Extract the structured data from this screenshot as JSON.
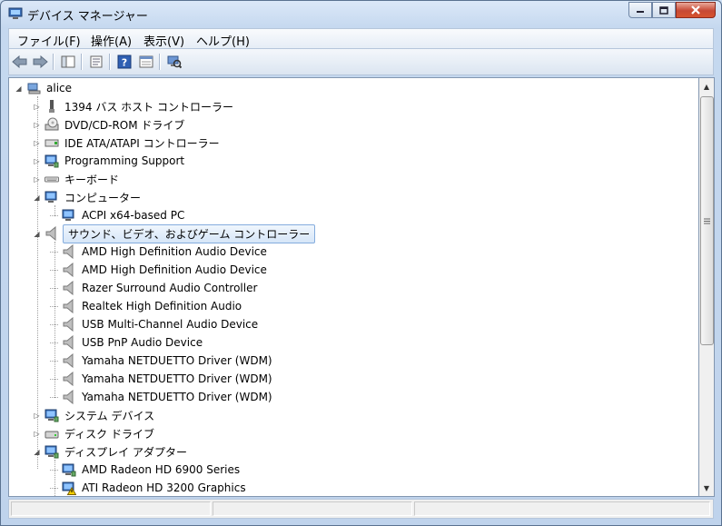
{
  "window": {
    "title": "デバイス マネージャー"
  },
  "menu": [
    {
      "label": "ファイル(F)"
    },
    {
      "label": "操作(A)"
    },
    {
      "label": "表示(V)"
    },
    {
      "label": "ヘルプ(H)"
    }
  ],
  "toolbar": {
    "buttons": [
      "back-arrow-icon",
      "forward-arrow-icon",
      "show-hide-tree-icon",
      "properties-icon",
      "help-icon",
      "view-icon",
      "scan-hardware-icon"
    ]
  },
  "tree": {
    "root": "alice",
    "items": [
      {
        "label": "1394 バス ホスト コントローラー",
        "icon": "bus-icon",
        "level": 1,
        "state": "collapsed"
      },
      {
        "label": "DVD/CD-ROM ドライブ",
        "icon": "dvd-icon",
        "level": 1,
        "state": "collapsed"
      },
      {
        "label": "IDE ATA/ATAPI コントローラー",
        "icon": "ide-icon",
        "level": 1,
        "state": "collapsed"
      },
      {
        "label": "Programming Support",
        "icon": "monitor-icon",
        "level": 1,
        "state": "collapsed"
      },
      {
        "label": "キーボード",
        "icon": "keyboard-icon",
        "level": 1,
        "state": "collapsed"
      },
      {
        "label": "コンピューター",
        "icon": "computer-icon",
        "level": 1,
        "state": "expanded"
      },
      {
        "label": "ACPI x64-based PC",
        "icon": "computer-icon",
        "level": 2,
        "state": "leaf"
      },
      {
        "label": "サウンド、ビデオ、およびゲーム コントローラー",
        "icon": "speaker-icon",
        "level": 1,
        "state": "expanded",
        "selected": true
      },
      {
        "label": "AMD High Definition Audio Device",
        "icon": "speaker-icon",
        "level": 2,
        "state": "leaf"
      },
      {
        "label": "AMD High Definition Audio Device",
        "icon": "speaker-icon",
        "level": 2,
        "state": "leaf"
      },
      {
        "label": "Razer Surround Audio Controller",
        "icon": "speaker-icon",
        "level": 2,
        "state": "leaf"
      },
      {
        "label": "Realtek High Definition Audio",
        "icon": "speaker-icon",
        "level": 2,
        "state": "leaf"
      },
      {
        "label": "USB Multi-Channel Audio Device",
        "icon": "speaker-icon",
        "level": 2,
        "state": "leaf"
      },
      {
        "label": "USB PnP Audio Device",
        "icon": "speaker-icon",
        "level": 2,
        "state": "leaf"
      },
      {
        "label": "Yamaha NETDUETTO Driver (WDM)",
        "icon": "speaker-icon",
        "level": 2,
        "state": "leaf"
      },
      {
        "label": "Yamaha NETDUETTO Driver (WDM)",
        "icon": "speaker-icon",
        "level": 2,
        "state": "leaf"
      },
      {
        "label": "Yamaha NETDUETTO Driver (WDM)",
        "icon": "speaker-icon",
        "level": 2,
        "state": "leaf"
      },
      {
        "label": "システム デバイス",
        "icon": "monitor-icon",
        "level": 1,
        "state": "collapsed"
      },
      {
        "label": "ディスク ドライブ",
        "icon": "disk-icon",
        "level": 1,
        "state": "collapsed"
      },
      {
        "label": "ディスプレイ アダプター",
        "icon": "monitor-icon",
        "level": 1,
        "state": "expanded"
      },
      {
        "label": "AMD Radeon HD 6900 Series",
        "icon": "monitor-icon",
        "level": 2,
        "state": "leaf"
      },
      {
        "label": "ATI Radeon HD 3200 Graphics",
        "icon": "monitor-warning-icon",
        "level": 2,
        "state": "leaf"
      }
    ]
  },
  "colors": {
    "selection": "#d6e6f8",
    "selection_border": "#84acdd",
    "close": "#c74934"
  }
}
